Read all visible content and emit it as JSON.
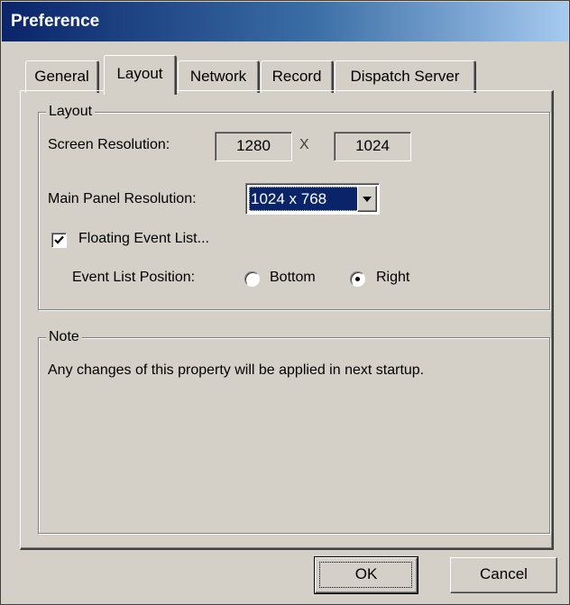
{
  "window": {
    "title": "Preference"
  },
  "tabs": [
    {
      "label": "General",
      "active": false
    },
    {
      "label": "Layout",
      "active": true
    },
    {
      "label": "Network",
      "active": false
    },
    {
      "label": "Record",
      "active": false
    },
    {
      "label": "Dispatch Server",
      "active": false
    }
  ],
  "layout_group": {
    "title": "Layout",
    "screen_resolution_label": "Screen Resolution:",
    "screen_width": "1280",
    "separator": "X",
    "screen_height": "1024",
    "main_panel_label": "Main Panel Resolution:",
    "main_panel_value": "1024 x 768",
    "floating_label": "Floating Event List...",
    "floating_checked": true,
    "position_label": "Event List Position:",
    "option_bottom": "Bottom",
    "option_right": "Right",
    "selected_position": "Right"
  },
  "note_group": {
    "title": "Note",
    "text": "Any changes of this property will be applied in next startup."
  },
  "buttons": {
    "ok": "OK",
    "cancel": "Cancel"
  },
  "colors": {
    "face": "#d4d0c8",
    "titlebar_start": "#0a246a",
    "titlebar_end": "#a6caf0",
    "selection": "#0a246a"
  }
}
